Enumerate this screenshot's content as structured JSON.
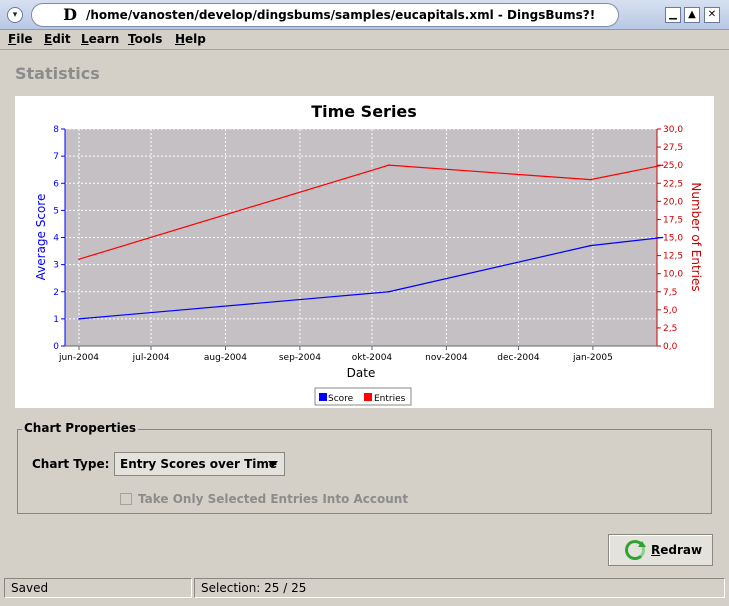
{
  "window": {
    "title": "/home/vanosten/develop/dingsbums/samples/eucapitals.xml - DingsBums?!",
    "app_icon": "D",
    "menu_button_icon": "window-menu-icon",
    "controls": {
      "minimize": "▁",
      "maximize": "▲",
      "close": "✕"
    }
  },
  "menu": {
    "items": [
      "File",
      "Edit",
      "Learn",
      "Tools",
      "Help"
    ]
  },
  "section_title": "Statistics",
  "chart_data": {
    "type": "line",
    "title": "Time Series",
    "xlabel": "Date",
    "ylabel_left": "Average Score",
    "ylabel_right": "Number of Entries",
    "x_ticks": [
      "jun-2004",
      "jul-2004",
      "aug-2004",
      "sep-2004",
      "okt-2004",
      "nov-2004",
      "dec-2004",
      "jan-2005"
    ],
    "y_left_ticks": [
      "0",
      "1",
      "2",
      "3",
      "4",
      "5",
      "6",
      "7",
      "8"
    ],
    "y_right_ticks": [
      "0,0",
      "2,5",
      "5,0",
      "7,5",
      "10,0",
      "12,5",
      "15,0",
      "17,5",
      "20,0",
      "22,5",
      "25,0",
      "27,5",
      "30,0"
    ],
    "ylim_left": [
      0,
      8
    ],
    "ylim_right": [
      0,
      30
    ],
    "grid": true,
    "legend_placement": "bottom",
    "colors": {
      "score": "#0000ff",
      "entries": "#ff0000",
      "plot_bg": "#c4c0c4",
      "grid": "#ffffff"
    },
    "series": [
      {
        "name": "Score",
        "axis": "left",
        "x": [
          "2004-06-01",
          "2004-10-08",
          "2004-12-31",
          "2005-01-30"
        ],
        "values": [
          1.0,
          2.0,
          3.7,
          4.0
        ]
      },
      {
        "name": "Entries",
        "axis": "right",
        "x": [
          "2004-06-01",
          "2004-10-08",
          "2004-12-31",
          "2005-01-30"
        ],
        "values": [
          12.0,
          25.0,
          23.0,
          25.0
        ]
      }
    ]
  },
  "chart_properties": {
    "legend": "Chart Properties",
    "chart_type_label": "Chart Type:",
    "chart_type_value": "Entry Scores over Time",
    "selected_only_label": "Take Only Selected Entries Into Account",
    "selected_only_checked": false
  },
  "redraw": {
    "label": "Redraw",
    "icon": "refresh-icon"
  },
  "status": {
    "left": "Saved",
    "right": "Selection: 25 / 25"
  }
}
